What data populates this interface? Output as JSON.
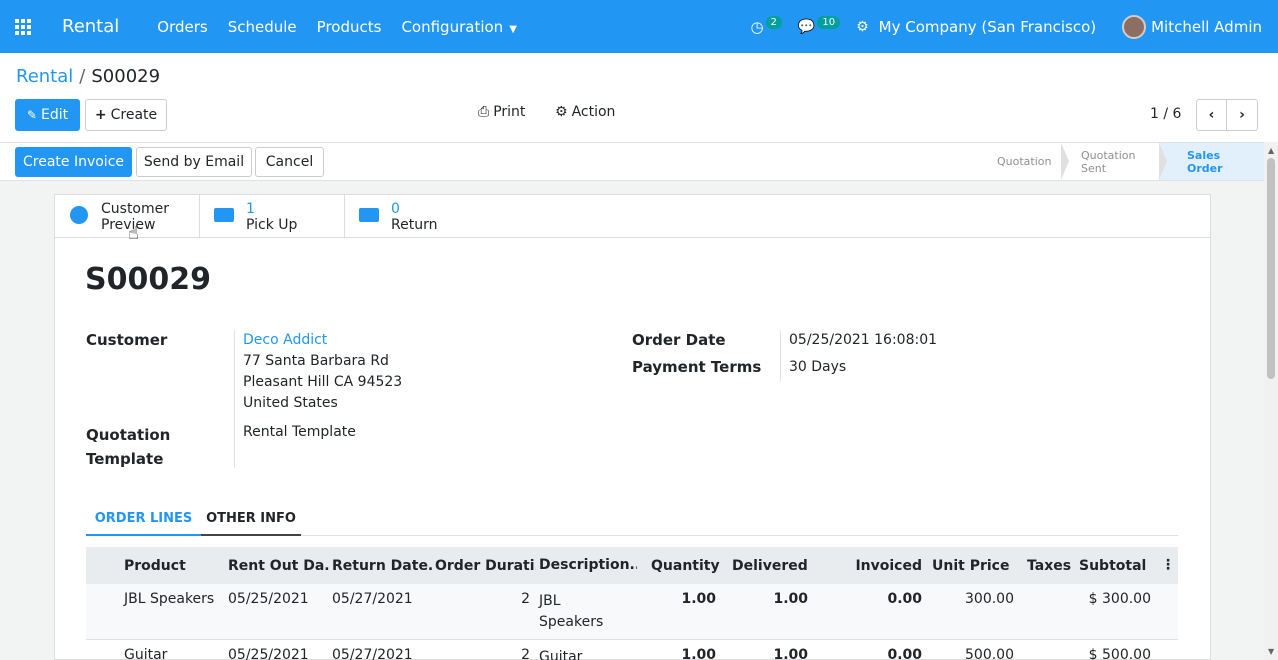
{
  "navbar": {
    "brand": "Rental",
    "menu": [
      "Orders",
      "Schedule",
      "Products",
      "Configuration"
    ],
    "activity_badge": "2",
    "messages_badge": "10",
    "company": "My Company (San Francisco)",
    "user": "Mitchell Admin"
  },
  "breadcrumb": {
    "parent": "Rental",
    "current": "S00029"
  },
  "toolbar": {
    "edit_label": "Edit",
    "create_label": "Create",
    "print_label": "Print",
    "action_label": "Action",
    "pager": "1 / 6"
  },
  "statusbar": {
    "create_invoice": "Create Invoice",
    "send_email": "Send by Email",
    "cancel": "Cancel",
    "stages": [
      "Quotation",
      "Quotation Sent",
      "Sales Order"
    ],
    "active_stage": "Sales Order"
  },
  "smart_buttons": {
    "customer_preview": [
      "Customer",
      "Preview"
    ],
    "pickup_count": "1",
    "pickup_label": "Pick Up",
    "return_count": "0",
    "return_label": "Return"
  },
  "order": {
    "name": "S00029",
    "customer_label": "Customer",
    "customer_name": "Deco Addict",
    "address": [
      "77 Santa Barbara Rd",
      "Pleasant Hill CA 94523",
      "United States"
    ],
    "template_label": [
      "Quotation",
      "Template"
    ],
    "template_value": "Rental Template",
    "order_date_label": "Order Date",
    "order_date": "05/25/2021 16:08:01",
    "payment_terms_label": "Payment Terms",
    "payment_terms": "30 Days"
  },
  "tabs": {
    "order_lines": "ORDER LINES",
    "other_info": "OTHER INFO"
  },
  "table": {
    "headers": [
      "Product",
      "Rent Out Da...",
      "Return Date...",
      "Order Durati...",
      "Description...",
      "Quantity",
      "Delivered",
      "Invoiced",
      "Unit Price",
      "Taxes",
      "Subtotal"
    ],
    "rows": [
      {
        "product": "JBL Speakers",
        "rent_out": "05/25/2021",
        "return": "05/27/2021",
        "duration": "2",
        "description": [
          "JBL",
          "Speakers"
        ],
        "quantity": "1.00",
        "delivered": "1.00",
        "invoiced": "0.00",
        "unit_price": "300.00",
        "taxes": "",
        "subtotal": "$ 300.00"
      },
      {
        "product": "Guitar",
        "rent_out": "05/25/2021",
        "return": "05/27/2021",
        "duration": "2",
        "description": [
          "Guitar",
          ""
        ],
        "quantity": "1.00",
        "delivered": "1.00",
        "invoiced": "0.00",
        "unit_price": "500.00",
        "taxes": "",
        "subtotal": "$ 500.00"
      }
    ]
  }
}
